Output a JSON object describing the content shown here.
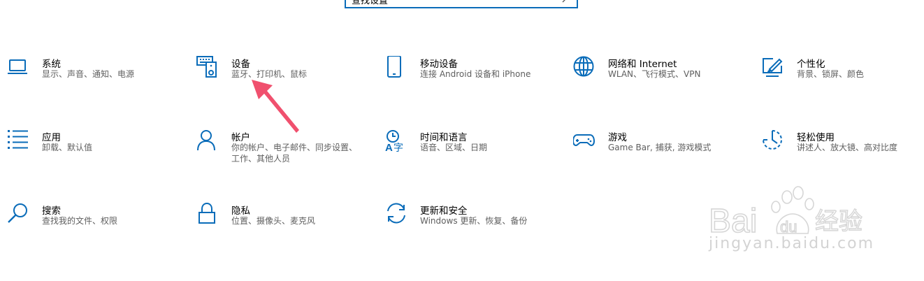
{
  "search": {
    "text": "查找设置"
  },
  "tiles": [
    {
      "title": "系统",
      "desc": "显示、声音、通知、电源",
      "icon": "laptop-icon"
    },
    {
      "title": "设备",
      "desc": "蓝牙、打印机、鼠标",
      "icon": "devices-icon"
    },
    {
      "title": "移动设备",
      "desc": "连接 Android 设备和 iPhone",
      "icon": "phone-icon"
    },
    {
      "title": "网络和 Internet",
      "desc": "WLAN、飞行模式、VPN",
      "icon": "globe-icon"
    },
    {
      "title": "个性化",
      "desc": "背景、锁屏、颜色",
      "icon": "personalization-icon"
    },
    {
      "title": "应用",
      "desc": "卸载、默认值",
      "icon": "apps-list-icon"
    },
    {
      "title": "帐户",
      "desc": "你的帐户、电子邮件、同步设置、工作、其他人员",
      "icon": "person-icon"
    },
    {
      "title": "时间和语言",
      "desc": "语音、区域、日期",
      "icon": "time-language-icon"
    },
    {
      "title": "游戏",
      "desc": "Game Bar, 捕获, 游戏模式",
      "icon": "gamepad-icon"
    },
    {
      "title": "轻松使用",
      "desc": "讲述人、放大镜、高对比度",
      "icon": "ease-of-access-icon"
    },
    {
      "title": "搜索",
      "desc": "查找我的文件、权限",
      "icon": "search-magnifier-icon"
    },
    {
      "title": "隐私",
      "desc": "位置、摄像头、麦克风",
      "icon": "lock-icon"
    },
    {
      "title": "更新和安全",
      "desc": "Windows 更新、恢复、备份",
      "icon": "refresh-icon"
    }
  ],
  "watermark": {
    "logo": "Bai du 经验",
    "site": "jingyan.baidu.com"
  },
  "colors": {
    "accent": "#0a6cb9",
    "arrow": "#f0506e"
  }
}
